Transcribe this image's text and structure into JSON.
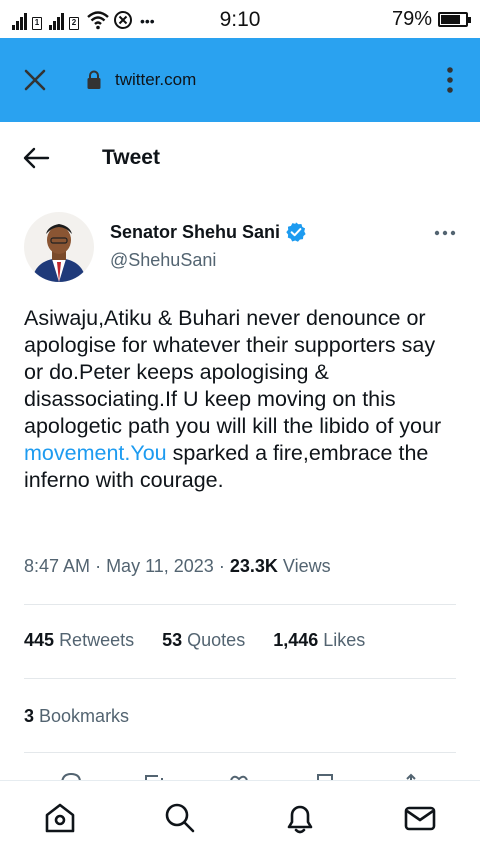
{
  "status_bar": {
    "time": "9:10",
    "battery_percent": "79%",
    "battery_level": 0.79,
    "sim1": "1",
    "sim2": "2",
    "more": "•••"
  },
  "browser": {
    "url": "twitter.com"
  },
  "header": {
    "title": "Tweet"
  },
  "tweet": {
    "author_name": "Senator Shehu Sani",
    "author_handle": "@ShehuSani",
    "text_before_link": "Asiwaju,Atiku & Buhari never denounce or apologise for whatever their supporters say or do.Peter keeps apologising & disassociating.If U keep moving on this apologetic path you will kill the libido of your ",
    "link_text": "movement.You",
    "text_after_link": " sparked a fire,embrace the inferno with courage.",
    "time": "8:47 AM",
    "date": "May 11, 2023",
    "views_count": "23.3K",
    "views_label": "Views",
    "retweets_count": "445",
    "retweets_label": "Retweets",
    "quotes_count": "53",
    "quotes_label": "Quotes",
    "likes_count": "1,446",
    "likes_label": "Likes",
    "bookmarks_count": "3",
    "bookmarks_label": "Bookmarks"
  },
  "icons": {
    "close": "close-icon",
    "lock": "lock-icon",
    "menu": "vertical-dots-icon",
    "back": "arrow-left-icon",
    "verified": "verified-badge-icon",
    "more": "horizontal-dots-icon",
    "home": "home-icon",
    "search": "search-icon",
    "notifications": "bell-icon",
    "messages": "envelope-icon"
  },
  "colors": {
    "browser_bar": "#2aa2f0",
    "link": "#1d9bf0",
    "verified": "#1d9bf0",
    "secondary_text": "#536471"
  }
}
